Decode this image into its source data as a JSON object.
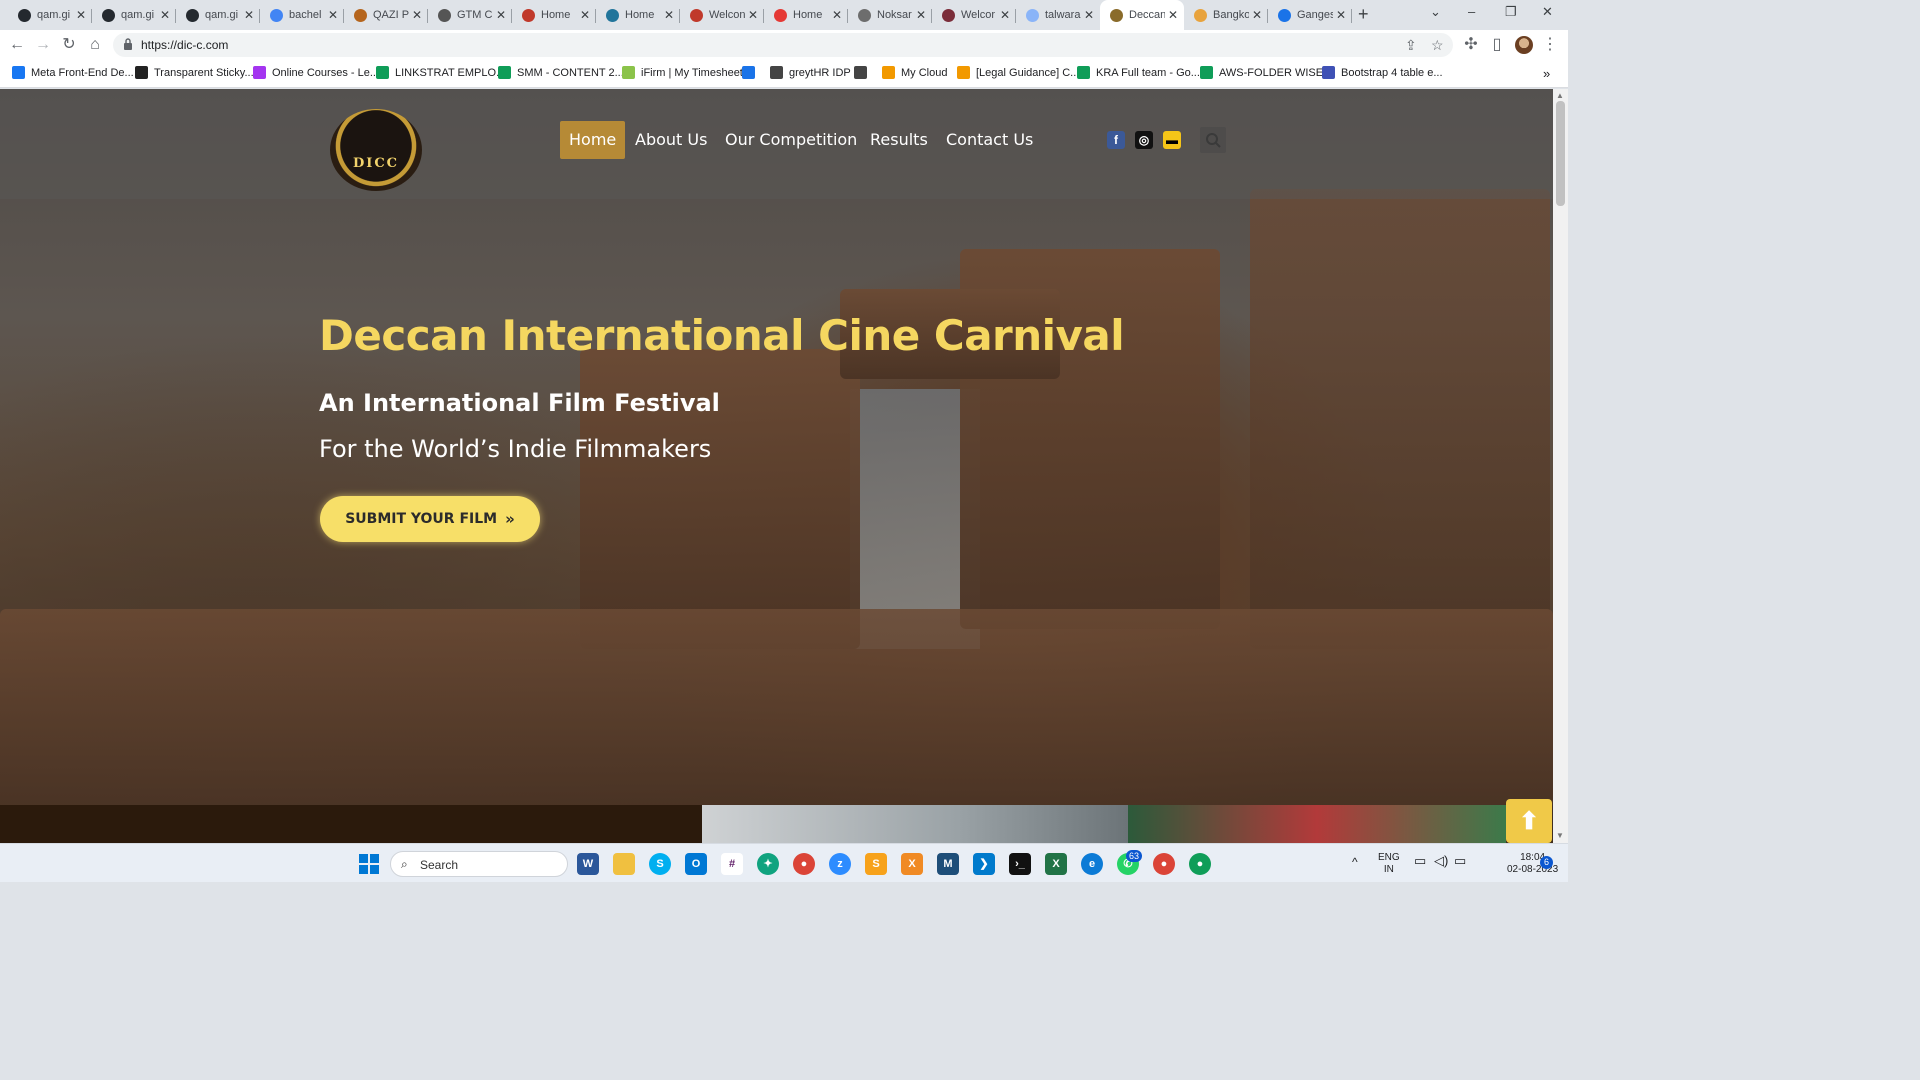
{
  "browser": {
    "tabs": [
      {
        "title": "qam.gi",
        "color": "#24292f",
        "icon": "github-icon"
      },
      {
        "title": "qam.gi",
        "color": "#24292f",
        "icon": "github-icon"
      },
      {
        "title": "qam.gi",
        "color": "#24292f",
        "icon": "github-icon"
      },
      {
        "title": "bachel",
        "color": "#4285f4",
        "icon": "google-icon"
      },
      {
        "title": "QAZI P",
        "color": "#b5651d",
        "icon": "site-icon"
      },
      {
        "title": "GTM C",
        "color": "#555555",
        "icon": "site-icon"
      },
      {
        "title": "Home",
        "color": "#c0392b",
        "icon": "shield-icon"
      },
      {
        "title": "Home",
        "color": "#21759b",
        "icon": "wordpress-icon"
      },
      {
        "title": "Welcon",
        "color": "#c0392b",
        "icon": "site-icon"
      },
      {
        "title": "Home",
        "color": "#e53935",
        "icon": "pin-icon"
      },
      {
        "title": "Noksar",
        "color": "#6d6d6d",
        "icon": "site-icon"
      },
      {
        "title": "Welcor",
        "color": "#7b2d3a",
        "icon": "site-icon"
      },
      {
        "title": "talwara",
        "color": "#8ab4f8",
        "icon": "loading-icon"
      },
      {
        "title": "Deccan",
        "color": "#8a6b2a",
        "icon": "dicc-icon"
      },
      {
        "title": "Bangko",
        "color": "#e8a33d",
        "icon": "site-icon"
      },
      {
        "title": "Ganges",
        "color": "#1a73e8",
        "icon": "site-icon"
      }
    ],
    "active_tab_index": 13,
    "url": "https://dic-c.com",
    "bookmarks": [
      {
        "label": "Meta Front-End De...",
        "icon": "meta-icon",
        "color": "#1877f2"
      },
      {
        "label": "Transparent Sticky...",
        "icon": "pen-icon",
        "color": "#222222"
      },
      {
        "label": "Online Courses - Le...",
        "icon": "udemy-icon",
        "color": "#a435f0"
      },
      {
        "label": "LINKSTRAT EMPLO...",
        "icon": "sheets-icon",
        "color": "#0f9d58"
      },
      {
        "label": "SMM - CONTENT 2...",
        "icon": "sheets-icon",
        "color": "#0f9d58"
      },
      {
        "label": "iFirm | My Timesheet",
        "icon": "ifirm-icon",
        "color": "#8bc34a"
      },
      {
        "label": "",
        "icon": "site-icon",
        "color": "#1a73e8"
      },
      {
        "label": "greytHR IDP",
        "icon": "globe-icon",
        "color": "#444444"
      },
      {
        "label": "",
        "icon": "globe-icon",
        "color": "#444444"
      },
      {
        "label": "My Cloud",
        "icon": "cloud-icon",
        "color": "#f29900"
      },
      {
        "label": "[Legal Guidance] C...",
        "icon": "site-icon",
        "color": "#f29900"
      },
      {
        "label": "KRA Full team - Go...",
        "icon": "sheets-icon",
        "color": "#0f9d58"
      },
      {
        "label": "AWS-FOLDER WISE...",
        "icon": "sheets-icon",
        "color": "#0f9d58"
      },
      {
        "label": "Bootstrap 4 table e...",
        "icon": "mdb-icon",
        "color": "#3f51b5"
      }
    ]
  },
  "site": {
    "logo_text": "DICC",
    "nav": [
      "Home",
      "About Us",
      "Our Competition",
      "Results",
      "Contact Us"
    ],
    "active_nav": "Home",
    "social": [
      {
        "name": "facebook-icon",
        "glyph": "f",
        "bg": "#3b5998",
        "fg": "#ffffff"
      },
      {
        "name": "instagram-icon",
        "glyph": "◎",
        "bg": "#111111",
        "fg": "#ffffff"
      },
      {
        "name": "imdb-icon",
        "glyph": "▬",
        "bg": "#f5c518",
        "fg": "#000000"
      }
    ],
    "hero": {
      "title": "Deccan International Cine Carnival",
      "subtitle": "An International Film Festival",
      "tagline": "For the World’s Indie Filmmakers",
      "cta": "SUBMIT YOUR FILM",
      "cta_glyph": "»"
    },
    "accent": "#f5d760",
    "nav_active_bg": "#b68a36"
  },
  "taskbar": {
    "search_label": "Search",
    "language": "ENG",
    "region": "IN",
    "time": "18:04",
    "date": "02-08-2023",
    "notification_count": "6",
    "whatsapp_badge": "63"
  }
}
